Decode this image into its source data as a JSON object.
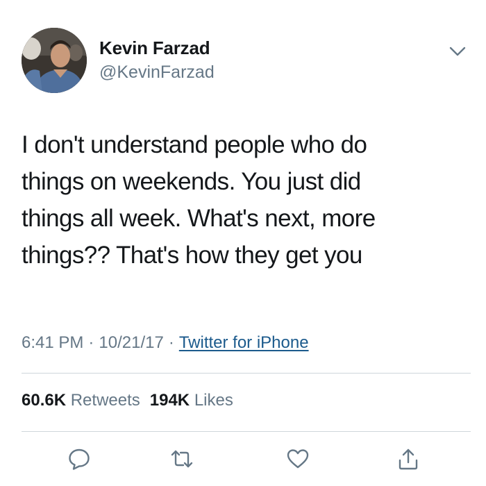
{
  "tweet": {
    "author": {
      "display_name": "Kevin Farzad",
      "handle": "@KevinFarzad"
    },
    "text": "I don't understand people who do\nthings on weekends. You just did\nthings all week. What's next, more\nthings?? That's how they get you",
    "meta": {
      "time": "6:41 PM",
      "separator": "·",
      "date": "10/21/17",
      "source": "Twitter for iPhone"
    },
    "stats": {
      "retweets_count": "60.6K",
      "retweets_label": "Retweets",
      "likes_count": "194K",
      "likes_label": "Likes"
    },
    "actions": [
      {
        "icon": "reply-icon"
      },
      {
        "icon": "retweet-icon"
      },
      {
        "icon": "like-icon"
      },
      {
        "icon": "share-icon"
      }
    ],
    "menu_icon": "chevron-down-icon"
  },
  "colors": {
    "text_primary": "#14171a",
    "text_secondary": "#657786",
    "link": "#1b5a8c",
    "divider": "#cfd6db"
  }
}
